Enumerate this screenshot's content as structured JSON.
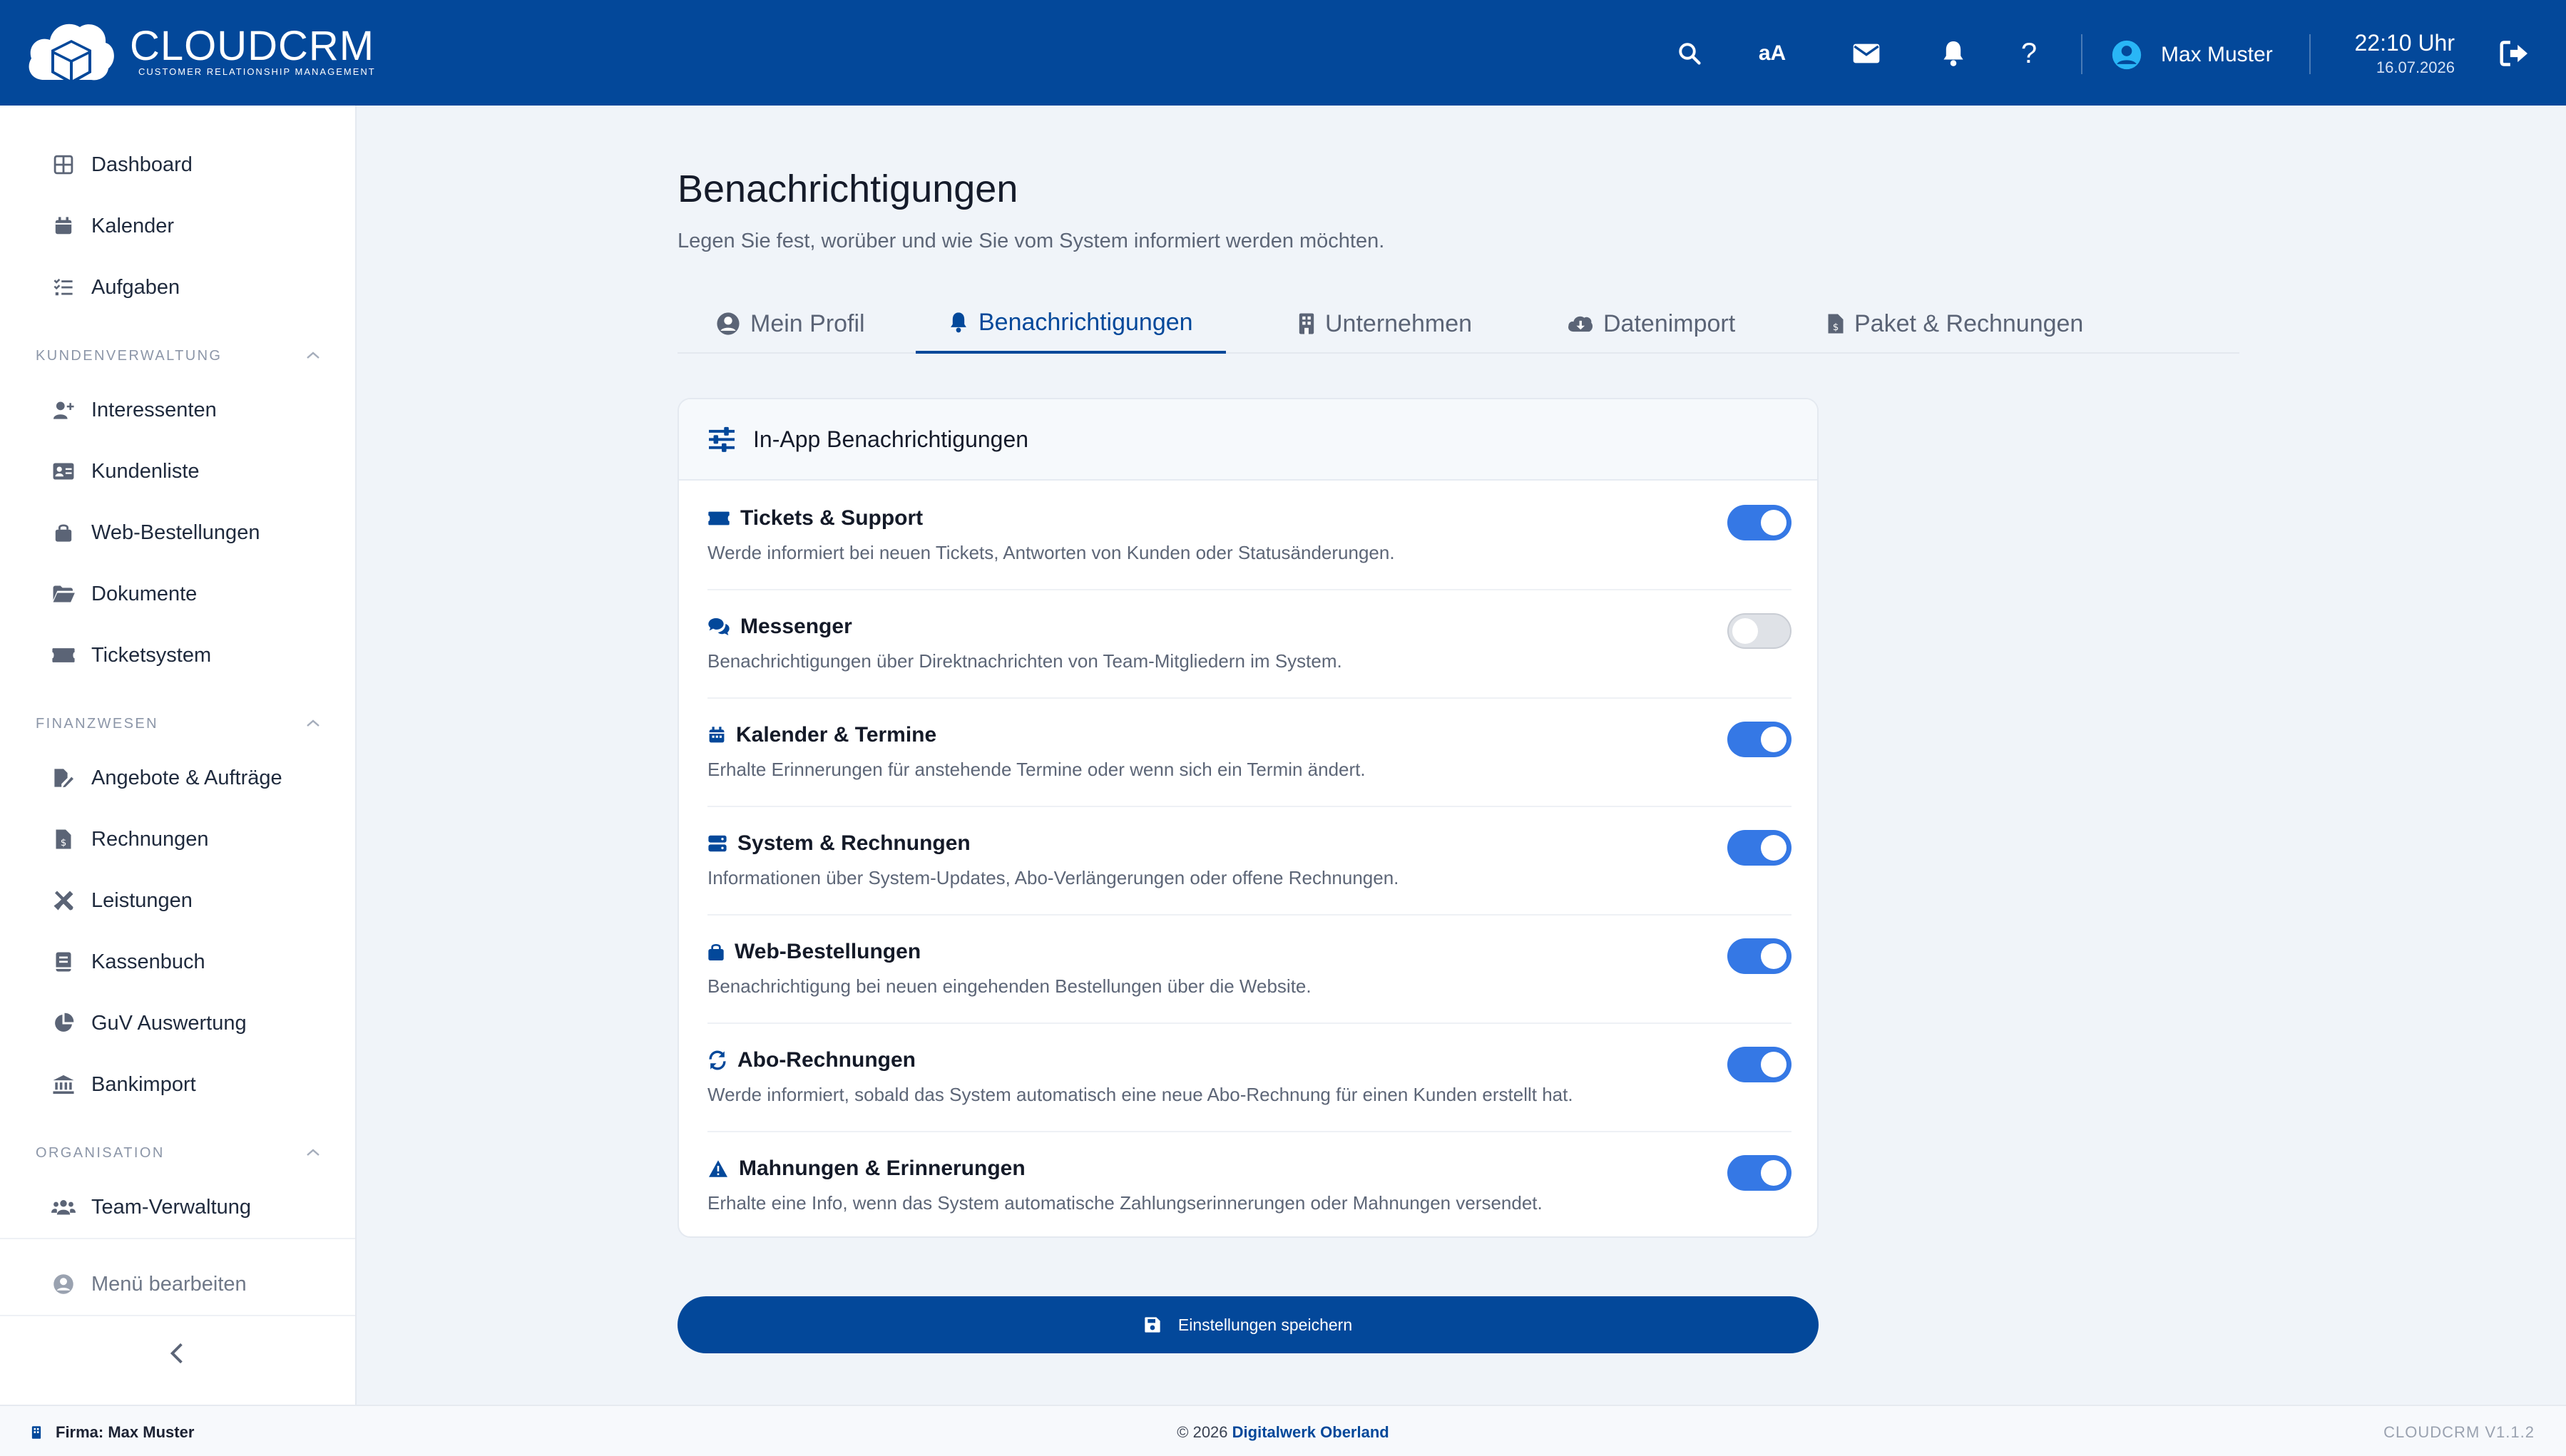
{
  "header": {
    "logo_title": "CLOUDCRM",
    "logo_subtitle": "CUSTOMER RELATIONSHIP MANAGEMENT",
    "font_size_label": "aA",
    "user_name": "Max Muster",
    "time": "22:10 Uhr",
    "date": "16.07.2026"
  },
  "sidebar": {
    "items_top": [
      {
        "label": "Dashboard",
        "icon": "grid-icon"
      },
      {
        "label": "Kalender",
        "icon": "calendar-icon"
      },
      {
        "label": "Aufgaben",
        "icon": "list-check-icon"
      }
    ],
    "sections": [
      {
        "title": "KUNDENVERWALTUNG",
        "items": [
          {
            "label": "Interessenten",
            "icon": "user-plus-icon"
          },
          {
            "label": "Kundenliste",
            "icon": "address-card-icon"
          },
          {
            "label": "Web-Bestellungen",
            "icon": "shopping-bag-icon"
          },
          {
            "label": "Dokumente",
            "icon": "folder-open-icon"
          },
          {
            "label": "Ticketsystem",
            "icon": "ticket-icon"
          }
        ]
      },
      {
        "title": "FINANZWESEN",
        "items": [
          {
            "label": "Angebote & Aufträge",
            "icon": "file-signature-icon"
          },
          {
            "label": "Rechnungen",
            "icon": "file-invoice-icon"
          },
          {
            "label": "Leistungen",
            "icon": "tools-icon"
          },
          {
            "label": "Kassenbuch",
            "icon": "book-icon"
          },
          {
            "label": "GuV Auswertung",
            "icon": "pie-chart-icon"
          },
          {
            "label": "Bankimport",
            "icon": "bank-icon"
          }
        ]
      },
      {
        "title": "ORGANISATION",
        "items": [
          {
            "label": "Team-Verwaltung",
            "icon": "users-icon"
          }
        ]
      }
    ],
    "menu_edit": "Menü bearbeiten"
  },
  "main": {
    "title": "Benachrichtigungen",
    "subtitle": "Legen Sie fest, worüber und wie Sie vom System informiert werden möchten.",
    "tabs": [
      {
        "label": "Mein Profil",
        "icon": "user-circle-icon"
      },
      {
        "label": "Benachrichtigungen",
        "icon": "bell-icon"
      },
      {
        "label": "Unternehmen",
        "icon": "building-icon"
      },
      {
        "label": "Datenimport",
        "icon": "cloud-download-icon"
      },
      {
        "label": "Paket & Rechnungen",
        "icon": "file-invoice-icon"
      }
    ],
    "active_tab": 1,
    "card_title": "In-App Benachrichtigungen",
    "notifications": [
      {
        "title": "Tickets & Support",
        "desc": "Werde informiert bei neuen Tickets, Antworten von Kunden oder Statusänderungen.",
        "enabled": true,
        "icon": "ticket-icon"
      },
      {
        "title": "Messenger",
        "desc": "Benachrichtigungen über Direktnachrichten von Team-Mitgliedern im System.",
        "enabled": false,
        "icon": "comments-icon"
      },
      {
        "title": "Kalender & Termine",
        "desc": "Erhalte Erinnerungen für anstehende Termine oder wenn sich ein Termin ändert.",
        "enabled": true,
        "icon": "calendar-icon"
      },
      {
        "title": "System & Rechnungen",
        "desc": "Informationen über System-Updates, Abo-Verlängerungen oder offene Rechnungen.",
        "enabled": true,
        "icon": "server-icon"
      },
      {
        "title": "Web-Bestellungen",
        "desc": "Benachrichtigung bei neuen eingehenden Bestellungen über die Website.",
        "enabled": true,
        "icon": "shopping-bag-icon"
      },
      {
        "title": "Abo-Rechnungen",
        "desc": "Werde informiert, sobald das System automatisch eine neue Abo-Rechnung für einen Kunden erstellt hat.",
        "enabled": true,
        "icon": "sync-icon"
      },
      {
        "title": "Mahnungen & Erinnerungen",
        "desc": "Erhalte eine Info, wenn das System automatische Zahlungserinnerungen oder Mahnungen versendet.",
        "enabled": true,
        "icon": "warning-icon"
      }
    ],
    "save_label": "Einstellungen speichern"
  },
  "footer": {
    "firma": "Firma: Max Muster",
    "copyright_prefix": "© 2026",
    "copyright_link": "Digitalwerk Oberland",
    "version": "CLOUDCRM V1.1.2"
  },
  "colors": {
    "brand": "#03489a",
    "toggle_on": "#3578e5",
    "toggle_off": "#dfe2e7"
  }
}
